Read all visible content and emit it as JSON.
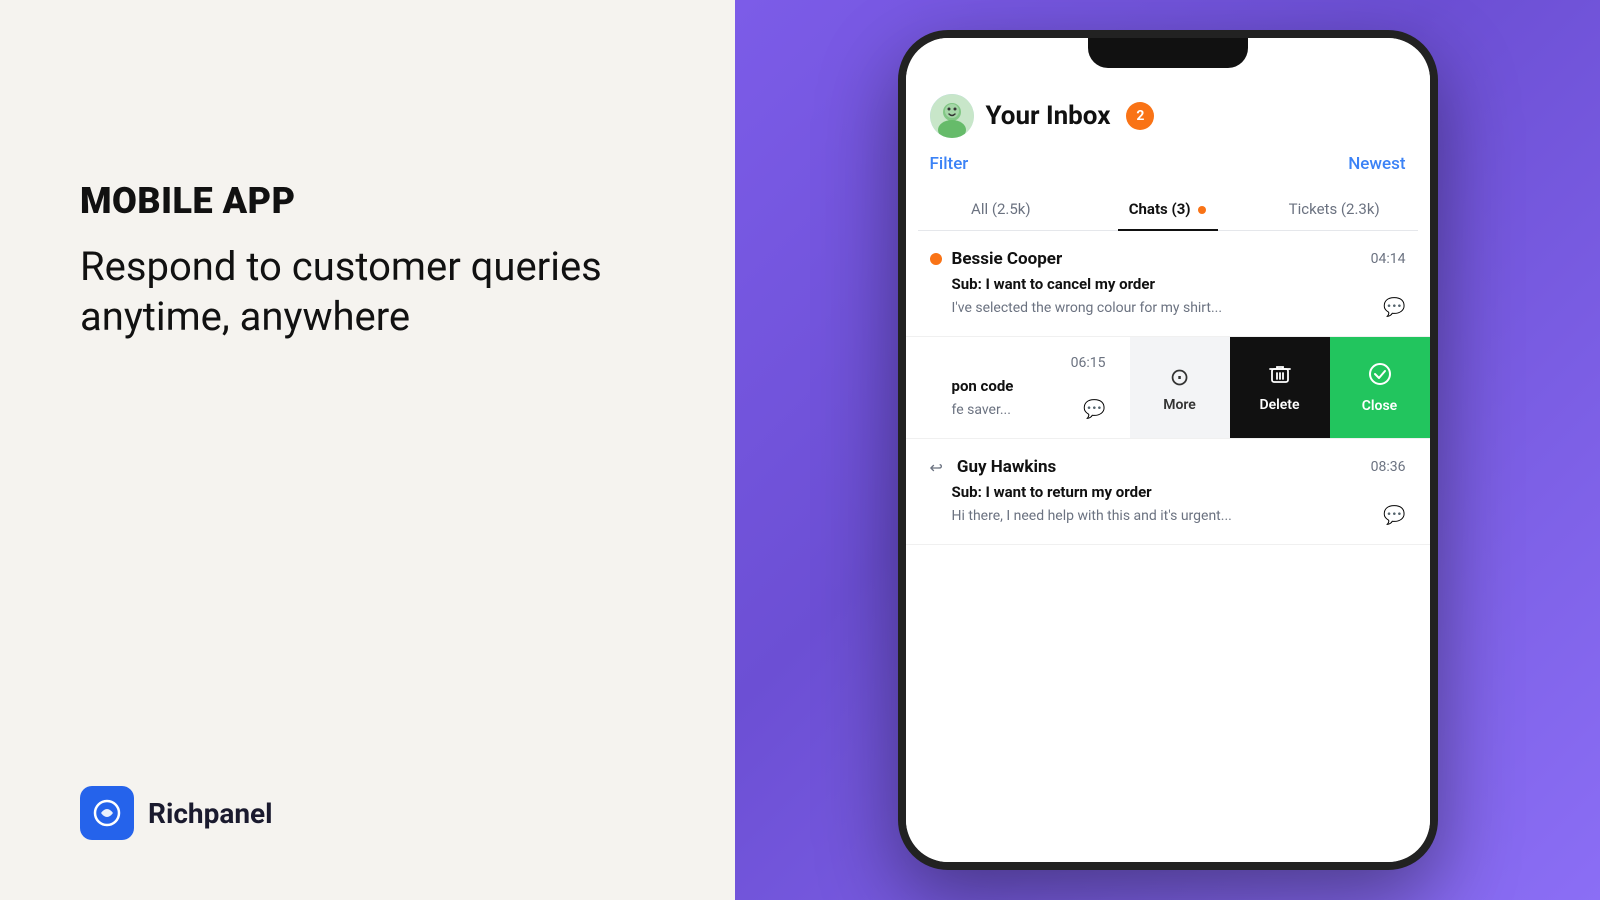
{
  "left": {
    "label": "MOBILE APP",
    "tagline_line1": "Respond to customer queries",
    "tagline_line2": "anytime, anywhere",
    "logo_text": "Richpanel"
  },
  "right": {
    "inbox_title": "Your Inbox",
    "inbox_badge": "2",
    "filter_label": "Filter",
    "newest_label": "Newest",
    "tabs": [
      {
        "label": "All (2.5k)",
        "active": false
      },
      {
        "label": "Chats (3)",
        "active": true,
        "dot": true
      },
      {
        "label": "Tickets (2.3k)",
        "active": false
      }
    ],
    "conversations": [
      {
        "name": "Bessie Cooper",
        "time": "04:14",
        "online": true,
        "subject": "Sub: I want to cancel my order",
        "preview": "I've selected the wrong colour for my shirt..."
      }
    ],
    "swipe_item": {
      "time": "06:15",
      "subject": "pon code",
      "preview": "fe saver...",
      "actions": [
        {
          "label": "More",
          "icon": "⊙"
        },
        {
          "label": "Delete",
          "icon": "🗑"
        },
        {
          "label": "Close",
          "icon": "✓"
        }
      ]
    },
    "third_conversation": {
      "name": "Guy Hawkins",
      "time": "08:36",
      "has_reply": true,
      "subject": "Sub: I want to return my order",
      "preview": "Hi there, I need help with this and it's urgent..."
    }
  }
}
